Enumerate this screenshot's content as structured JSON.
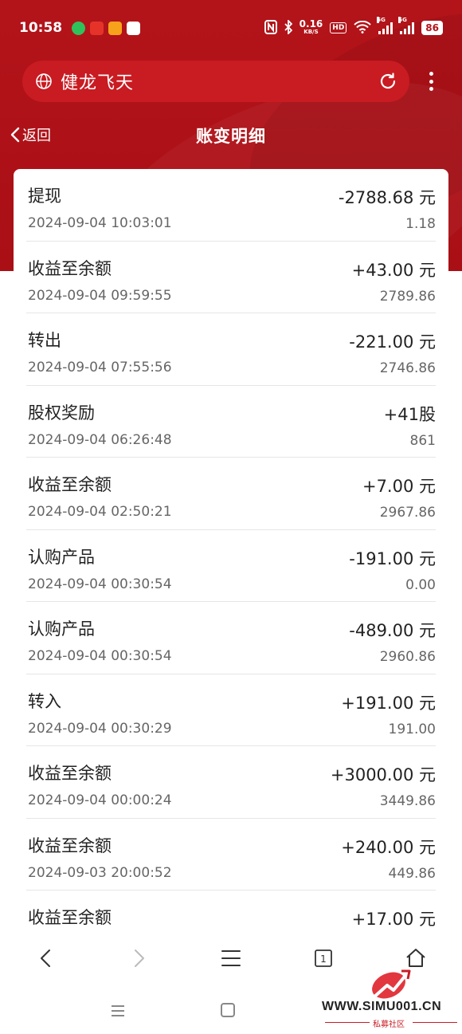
{
  "status_bar": {
    "time": "10:58",
    "net_speed_value": "0.16",
    "net_speed_unit": "KB/S",
    "hd_label": "HD",
    "signal_label_1": "5G",
    "signal_label_2": "5G",
    "battery": "86"
  },
  "browser": {
    "address_text": "健龙飞天"
  },
  "nav": {
    "back_label": "返回",
    "title": "账变明细"
  },
  "transactions": [
    {
      "title": "提现",
      "date": "2024-09-04 10:03:01",
      "amount": "-2788.68 元",
      "balance": "1.18"
    },
    {
      "title": "收益至余额",
      "date": "2024-09-04 09:59:55",
      "amount": "+43.00 元",
      "balance": "2789.86"
    },
    {
      "title": "转出",
      "date": "2024-09-04 07:55:56",
      "amount": "-221.00 元",
      "balance": "2746.86"
    },
    {
      "title": "股权奖励",
      "date": "2024-09-04 06:26:48",
      "amount": "+41股",
      "balance": "861"
    },
    {
      "title": "收益至余额",
      "date": "2024-09-04 02:50:21",
      "amount": "+7.00 元",
      "balance": "2967.86"
    },
    {
      "title": "认购产品",
      "date": "2024-09-04 00:30:54",
      "amount": "-191.00 元",
      "balance": "0.00"
    },
    {
      "title": "认购产品",
      "date": "2024-09-04 00:30:54",
      "amount": "-489.00 元",
      "balance": "2960.86"
    },
    {
      "title": "转入",
      "date": "2024-09-04 00:30:29",
      "amount": "+191.00 元",
      "balance": "191.00"
    },
    {
      "title": "收益至余额",
      "date": "2024-09-04 00:00:24",
      "amount": "+3000.00 元",
      "balance": "3449.86"
    },
    {
      "title": "收益至余额",
      "date": "2024-09-03 20:00:52",
      "amount": "+240.00 元",
      "balance": "449.86"
    },
    {
      "title": "收益至余额",
      "date": "",
      "amount": "+17.00 元",
      "balance": ""
    }
  ],
  "toolbar": {
    "tab_count": "1"
  },
  "watermark": {
    "text": "WWW.SIMU001.CN",
    "sub": "私募社区"
  },
  "colors": {
    "header_red": "#b3141a",
    "search_red": "#c91b22"
  }
}
